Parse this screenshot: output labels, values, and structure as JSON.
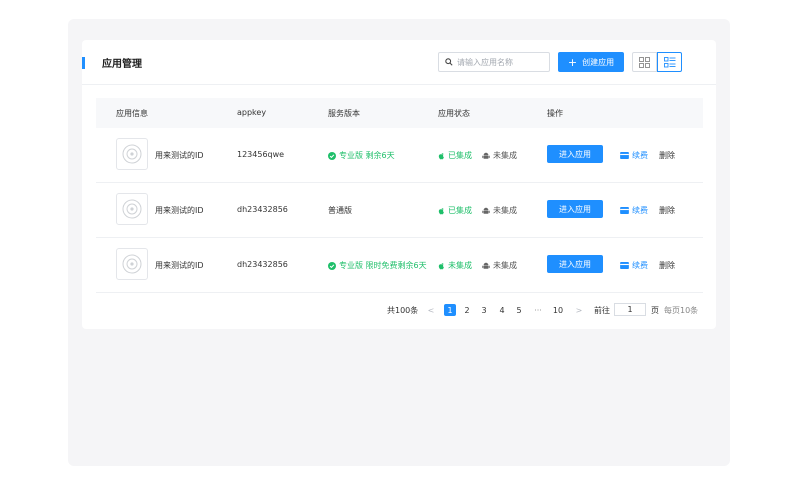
{
  "header": {
    "title": "应用管理",
    "search_placeholder": "请输入应用名称",
    "create_label": "创建应用"
  },
  "table": {
    "columns": [
      "应用信息",
      "appkey",
      "服务版本",
      "应用状态",
      "操作"
    ],
    "rows": [
      {
        "name": "用来测试的ID",
        "appkey": "123456qwe",
        "service": "专业版 剩余6天",
        "service_check": true,
        "ios_status": "已集成",
        "android_status": "未集成",
        "enter_label": "进入应用",
        "renew_label": "续费",
        "delete_label": "删除"
      },
      {
        "name": "用来测试的ID",
        "appkey": "dh23432856",
        "service": "普通版",
        "service_check": false,
        "ios_status": "已集成",
        "android_status": "未集成",
        "enter_label": "进入应用",
        "renew_label": "续费",
        "delete_label": "删除"
      },
      {
        "name": "用来测试的ID",
        "appkey": "dh23432856",
        "service": "专业版 限时免费剩余6天",
        "service_check": true,
        "ios_status": "未集成",
        "android_status": "未集成",
        "enter_label": "进入应用",
        "renew_label": "续费",
        "delete_label": "删除"
      }
    ]
  },
  "pagination": {
    "total": "共100条",
    "prev": "<",
    "pages": [
      "1",
      "2",
      "3",
      "4",
      "5"
    ],
    "ellipsis": "···",
    "last_page": "10",
    "next": ">",
    "goto_label": "前往",
    "goto_value": "1",
    "page_unit": "页",
    "page_size": "每页10条"
  },
  "colors": {
    "accent": "#1f8fff",
    "success": "#1fbf6a"
  }
}
